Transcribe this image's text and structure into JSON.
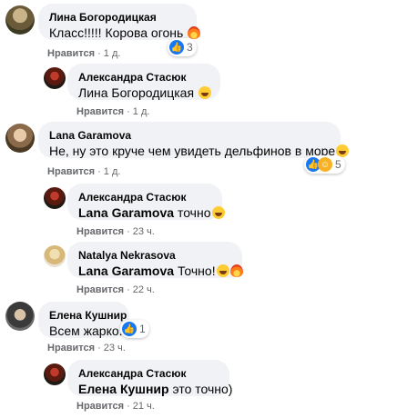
{
  "comments": [
    {
      "author": "Лина Богородицкая",
      "text": "Класс!!!!! Корова огонь",
      "like_label": "Нравится",
      "time": "1 д.",
      "reaction_count": "3",
      "replies": [
        {
          "author": "Александра Стасюк",
          "mention": "Лина Богородицкая",
          "text": "",
          "like_label": "Нравится",
          "time": "1 д."
        }
      ]
    },
    {
      "author": "Lana Garamova",
      "text": "Не, ну это круче чем увидеть дельфинов в море",
      "like_label": "Нравится",
      "time": "1 д.",
      "reaction_count": "5",
      "replies": [
        {
          "author": "Александра Стасюк",
          "mention": "Lana Garamova",
          "text": "точно",
          "like_label": "Нравится",
          "time": "23 ч."
        },
        {
          "author": "Natalya Nekrasova",
          "mention": "Lana Garamova",
          "text": "Точно!",
          "like_label": "Нравится",
          "time": "22 ч."
        }
      ]
    },
    {
      "author": "Елена Кушнир",
      "text": "Всем жарко.",
      "like_label": "Нравится",
      "time": "23 ч.",
      "reaction_count": "1",
      "replies": [
        {
          "author": "Александра Стасюк",
          "mention": "Елена Кушнир",
          "text": "это точно)",
          "like_label": "Нравится",
          "time": "21 ч."
        }
      ]
    }
  ],
  "icons": {
    "like": "like-icon",
    "haha": "haha-icon",
    "fire": "fire-emoji",
    "grin": "grin-emoji",
    "laugh": "laugh-emoji"
  },
  "colors": {
    "bubble_bg": "#f0f2f5",
    "meta_text": "#65676b",
    "like_blue": "#1877f2",
    "mention_blue": "#385898"
  }
}
